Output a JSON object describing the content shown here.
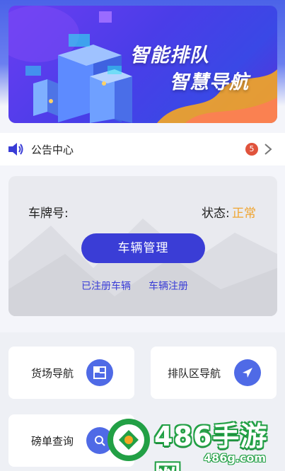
{
  "banner": {
    "title_line1": "智能排队",
    "title_line2": "智慧导航"
  },
  "notice": {
    "label": "公告中心",
    "count": "5",
    "icons": [
      "speaker-icon",
      "chevron-right-icon"
    ]
  },
  "vehicle": {
    "plate_label": "车牌号:",
    "plate_value": "",
    "status_label": "状态:",
    "status_value": "正常",
    "manage_button": "车辆管理",
    "link_registered": "已注册车辆",
    "link_register": "车辆注册"
  },
  "tiles": [
    {
      "label": "货场导航",
      "icon": "layout-icon"
    },
    {
      "label": "排队区导航",
      "icon": "navigation-arrow-icon"
    },
    {
      "label": "磅单查询",
      "icon": "search-icon"
    }
  ],
  "watermark": {
    "text": "486手游网",
    "url": "486g.com"
  },
  "colors": {
    "primary": "#3a3dd6",
    "status_ok": "#f0a531",
    "badge": "#e0533c",
    "icon_bg": "#4f6ae6"
  }
}
